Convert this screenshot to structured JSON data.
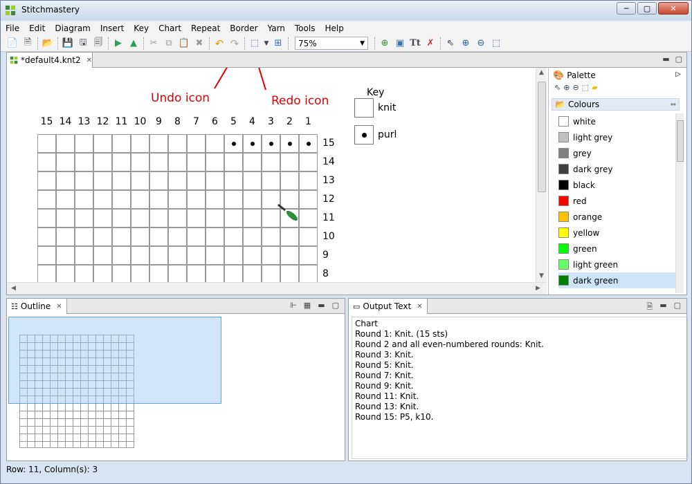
{
  "app": {
    "title": "Stitchmastery"
  },
  "window_controls": {
    "minimize": "─",
    "maximize": "▢",
    "close": "✕"
  },
  "menu": [
    "File",
    "Edit",
    "Diagram",
    "Insert",
    "Key",
    "Chart",
    "Repeat",
    "Border",
    "Yarn",
    "Tools",
    "Help"
  ],
  "toolbar": {
    "zoom_value": "75%"
  },
  "editor": {
    "tab_label": "*default4.knt2"
  },
  "annotations": {
    "undo": "Undo icon",
    "redo": "Redo icon"
  },
  "chart": {
    "column_numbers": [
      "15",
      "14",
      "13",
      "12",
      "11",
      "10",
      "9",
      "8",
      "7",
      "6",
      "5",
      "4",
      "3",
      "2",
      "1"
    ],
    "row_numbers": [
      "15",
      "14",
      "13",
      "12",
      "11",
      "10",
      "9",
      "8",
      "7"
    ],
    "purl_cells_top_row": [
      "5",
      "4",
      "3",
      "2",
      "1"
    ]
  },
  "key": {
    "title": "Key",
    "items": [
      {
        "label": "knit",
        "symbol": "empty"
      },
      {
        "label": "purl",
        "symbol": "dot"
      }
    ]
  },
  "palette": {
    "title": "Palette",
    "drawer": "Colours",
    "colours": [
      {
        "name": "white",
        "hex": "#ffffff"
      },
      {
        "name": "light grey",
        "hex": "#c0c0c0"
      },
      {
        "name": "grey",
        "hex": "#808080"
      },
      {
        "name": "dark grey",
        "hex": "#404040"
      },
      {
        "name": "black",
        "hex": "#000000"
      },
      {
        "name": "red",
        "hex": "#ff0000"
      },
      {
        "name": "orange",
        "hex": "#ffc000"
      },
      {
        "name": "yellow",
        "hex": "#ffff00"
      },
      {
        "name": "green",
        "hex": "#00ff00"
      },
      {
        "name": "light green",
        "hex": "#66ff66"
      },
      {
        "name": "dark green",
        "hex": "#008000"
      }
    ],
    "selected": "dark green"
  },
  "outline": {
    "tab_label": "Outline"
  },
  "output": {
    "tab_label": "Output Text",
    "lines": [
      "Chart",
      "Round 1: Knit. (15 sts)",
      "Round 2 and all even-numbered rounds: Knit.",
      "Round 3: Knit.",
      "Round 5: Knit.",
      "Round 7: Knit.",
      "Round 9: Knit.",
      "Round 11: Knit.",
      "Round 13: Knit.",
      "Round 15: P5, k10."
    ]
  },
  "status": {
    "text": "Row: 11, Column(s): 3"
  }
}
